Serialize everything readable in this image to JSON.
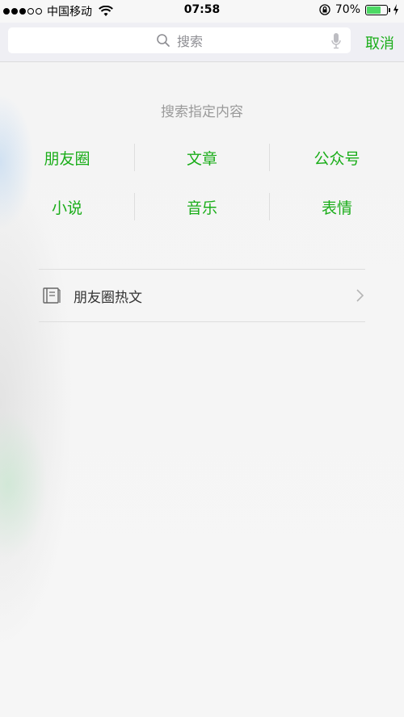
{
  "status_bar": {
    "carrier": "中国移动",
    "time": "07:58",
    "battery_percent": "70%",
    "battery_level": 0.7
  },
  "search": {
    "placeholder": "搜索",
    "cancel_label": "取消"
  },
  "section": {
    "title": "搜索指定内容",
    "items": [
      {
        "label": "朋友圈"
      },
      {
        "label": "文章"
      },
      {
        "label": "公众号"
      },
      {
        "label": "小说"
      },
      {
        "label": "音乐"
      },
      {
        "label": "表情"
      }
    ]
  },
  "hot_articles": {
    "label": "朋友圈热文",
    "icon": "book-icon"
  },
  "colors": {
    "accent": "#1aad19",
    "muted": "#9a9a9a"
  }
}
